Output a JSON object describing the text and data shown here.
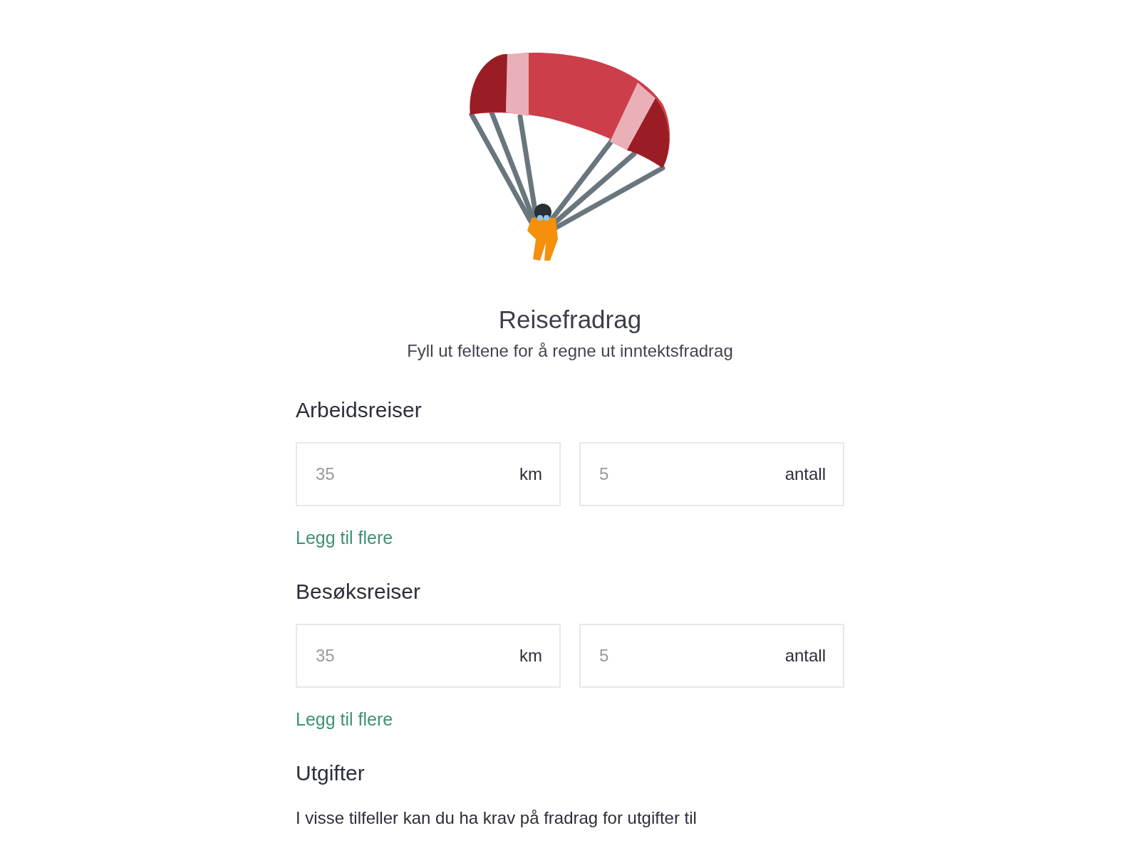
{
  "header": {
    "title": "Reisefradrag",
    "subtitle": "Fyll ut feltene for å regne ut inntektsfradrag"
  },
  "sections": [
    {
      "kind": "trips",
      "heading": "Arbeidsreiser",
      "fields": [
        {
          "placeholder": "35",
          "unit": "km"
        },
        {
          "placeholder": "5",
          "unit": "antall"
        }
      ],
      "link": "Legg til flere"
    },
    {
      "kind": "trips",
      "heading": "Besøksreiser",
      "fields": [
        {
          "placeholder": "35",
          "unit": "km"
        },
        {
          "placeholder": "5",
          "unit": "antall"
        }
      ],
      "link": "Legg til flere"
    },
    {
      "kind": "text",
      "heading": "Utgifter",
      "paragraph": "I visse tilfeller kan du ha krav på fradrag for utgifter til"
    }
  ]
}
